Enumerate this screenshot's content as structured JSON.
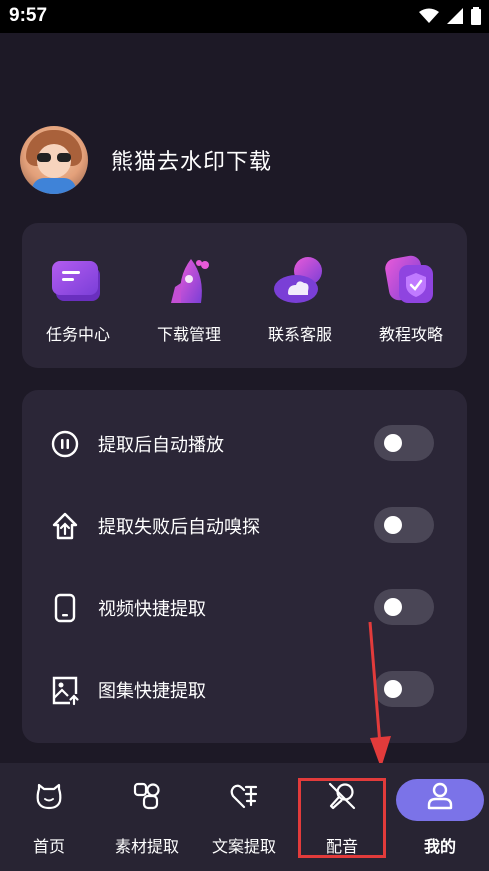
{
  "status_bar": {
    "time": "9:57"
  },
  "profile": {
    "name": "熊猫去水印下载"
  },
  "quick_actions": [
    {
      "label": "任务中心",
      "icon": "folder-icon"
    },
    {
      "label": "下载管理",
      "icon": "rocket-icon"
    },
    {
      "label": "联系客服",
      "icon": "cloud-icon"
    },
    {
      "label": "教程攻略",
      "icon": "shield-check-icon"
    }
  ],
  "settings": [
    {
      "label": "提取后自动播放",
      "icon": "pause-circle-icon",
      "enabled": false
    },
    {
      "label": "提取失败后自动嗅探",
      "icon": "upload-house-icon",
      "enabled": false
    },
    {
      "label": "视频快捷提取",
      "icon": "phone-icon",
      "enabled": false
    },
    {
      "label": "图集快捷提取",
      "icon": "image-upload-icon",
      "enabled": false
    }
  ],
  "bottom_nav": [
    {
      "label": "首页",
      "icon": "home-cat-icon"
    },
    {
      "label": "素材提取",
      "icon": "shapes-icon"
    },
    {
      "label": "文案提取",
      "icon": "text-extract-icon"
    },
    {
      "label": "配音",
      "icon": "microphone-icon"
    },
    {
      "label": "我的",
      "icon": "user-icon",
      "active": true
    }
  ],
  "colors": {
    "background": "#1d1926",
    "card": "#2b2637",
    "accent": "#7b73e8",
    "highlight": "#e23b3b"
  }
}
